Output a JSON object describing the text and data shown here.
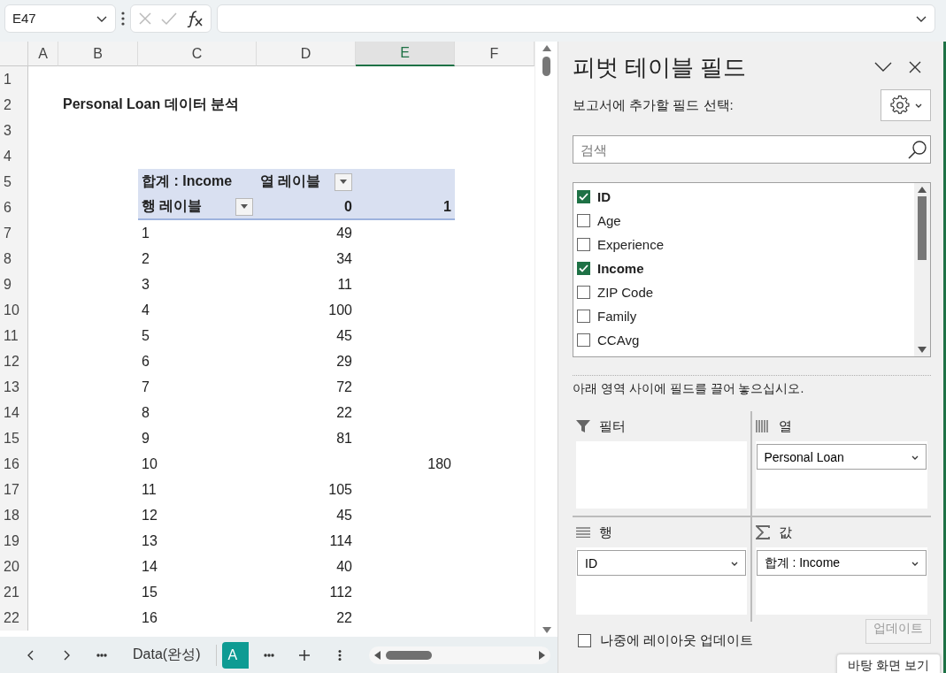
{
  "formula_bar": {
    "name_box": "E47"
  },
  "sheet": {
    "columns": [
      {
        "label": "A",
        "selected": false
      },
      {
        "label": "B",
        "selected": false
      },
      {
        "label": "C",
        "selected": false
      },
      {
        "label": "D",
        "selected": false
      },
      {
        "label": "E",
        "selected": true
      },
      {
        "label": "F",
        "selected": false
      }
    ],
    "row_numbers": [
      "1",
      "2",
      "3",
      "4",
      "5",
      "6",
      "7",
      "8",
      "9",
      "10",
      "11",
      "12",
      "13",
      "14",
      "15",
      "16",
      "17",
      "18",
      "19",
      "20",
      "21",
      "22"
    ],
    "title": "Personal Loan 데이터 분석",
    "pivot": {
      "value_label": "합계 : Income",
      "column_label": "열 레이블",
      "row_label": "행 레이블",
      "column_items": [
        "0",
        "1"
      ],
      "rows": [
        {
          "label": "1",
          "column_0": "49"
        },
        {
          "label": "2",
          "column_0": "34"
        },
        {
          "label": "3",
          "column_0": "11"
        },
        {
          "label": "4",
          "column_0": "100"
        },
        {
          "label": "5",
          "column_0": "45"
        },
        {
          "label": "6",
          "column_0": "29"
        },
        {
          "label": "7",
          "column_0": "72"
        },
        {
          "label": "8",
          "column_0": "22"
        },
        {
          "label": "9",
          "column_0": "81"
        },
        {
          "label": "10",
          "column_1": "180"
        },
        {
          "label": "11",
          "column_0": "105"
        },
        {
          "label": "12",
          "column_0": "45"
        },
        {
          "label": "13",
          "column_0": "114"
        },
        {
          "label": "14",
          "column_0": "40"
        },
        {
          "label": "15",
          "column_0": "112"
        },
        {
          "label": "16",
          "column_0": "22"
        }
      ]
    }
  },
  "sheet_tabs": [
    {
      "label": "Data(완성)",
      "selected": false
    },
    {
      "label": "A",
      "selected": true
    }
  ],
  "pivot_fields": {
    "title": "피벗 테이블 필드",
    "prompt": "보고서에 추가할 필드 선택:",
    "search": {
      "placeholder": "검색"
    },
    "fields": [
      {
        "label": "ID",
        "checked": true
      },
      {
        "label": "Age",
        "checked": false
      },
      {
        "label": "Experience",
        "checked": false
      },
      {
        "label": "Income",
        "checked": true
      },
      {
        "label": "ZIP Code",
        "checked": false
      },
      {
        "label": "Family",
        "checked": false
      },
      {
        "label": "CCAvg",
        "checked": false
      }
    ],
    "instruction": "아래 영역 사이에 필드를 끌어 놓으십시오.",
    "areas": [
      {
        "kind": "filter",
        "label": "필터"
      },
      {
        "kind": "columns",
        "label": "열",
        "items": [
          "Personal Loan"
        ]
      },
      {
        "kind": "rows",
        "label": "행",
        "items": [
          "ID"
        ]
      },
      {
        "kind": "values",
        "label": "값",
        "items": [
          "합계 : Income"
        ]
      }
    ],
    "defer_update": {
      "label": "나중에 레이아웃 업데이트",
      "checked": false
    },
    "update_button": {
      "label": "업데이트",
      "disabled": true
    }
  },
  "tooltip": "바탕 화면 보기"
}
